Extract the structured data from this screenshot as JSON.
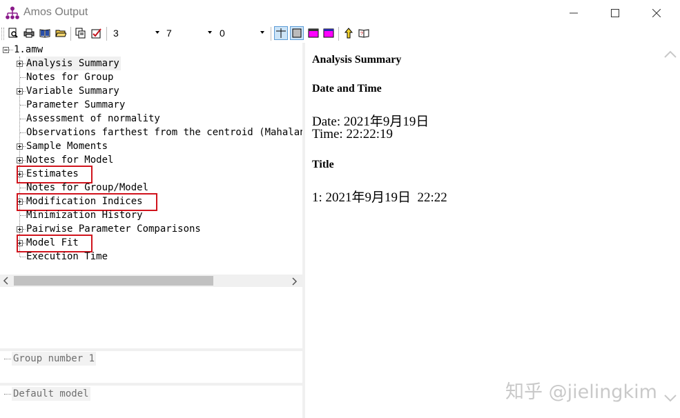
{
  "window": {
    "title": "Amos Output"
  },
  "toolbar": {
    "combo1": "3",
    "combo2": "7",
    "combo3": "0"
  },
  "tree": {
    "root": "1.amw",
    "items": [
      {
        "label": "Analysis Summary",
        "expandable": true,
        "selected": true
      },
      {
        "label": "Notes for Group",
        "expandable": false
      },
      {
        "label": "Variable Summary",
        "expandable": true
      },
      {
        "label": "Parameter Summary",
        "expandable": false
      },
      {
        "label": "Assessment of normality",
        "expandable": false
      },
      {
        "label": "Observations farthest from the centroid (Mahalanobis distance)",
        "expandable": false
      },
      {
        "label": "Sample Moments",
        "expandable": true
      },
      {
        "label": "Notes for Model",
        "expandable": true
      },
      {
        "label": "Estimates",
        "expandable": true,
        "highlighted": true
      },
      {
        "label": "Notes for Group/Model",
        "expandable": false
      },
      {
        "label": "Modification Indices",
        "expandable": true,
        "highlighted": true
      },
      {
        "label": "Minimization History",
        "expandable": false
      },
      {
        "label": "Pairwise Parameter Comparisons",
        "expandable": true
      },
      {
        "label": "Model Fit",
        "expandable": true,
        "highlighted": true
      },
      {
        "label": "Execution Time",
        "expandable": false
      }
    ]
  },
  "groups": {
    "item": "Group number 1"
  },
  "models": {
    "item": "Default model"
  },
  "output": {
    "heading": "Analysis Summary",
    "date_time_heading": "Date and Time",
    "date": "Date: 2021年9月19日",
    "time": "Time: 22:22:19",
    "title_heading": "Title",
    "title_line": "1: 2021年9月19日  22:22"
  },
  "watermark": "知乎 @jielingkim",
  "colors": {
    "highlight_border": "#d0121b",
    "toolbar_magenta": "#ff00ff"
  },
  "icons": [
    "app-tree-icon",
    "print-preview-icon",
    "print-icon",
    "book-icon",
    "open-folder-icon",
    "copy-icon",
    "options-icon",
    "split-pane-icon",
    "single-pane-icon",
    "table-icon",
    "table-alt-icon",
    "up-icon",
    "help-book-icon"
  ]
}
